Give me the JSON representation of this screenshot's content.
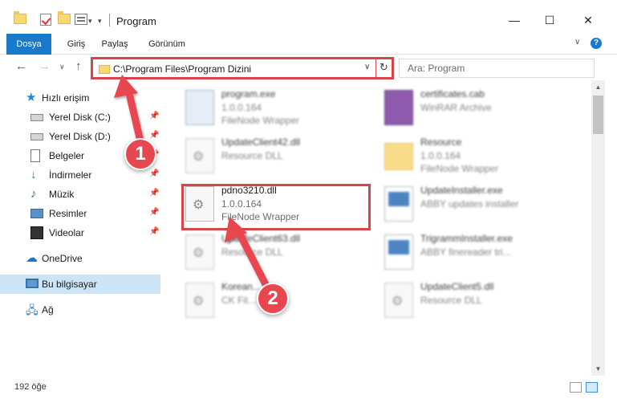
{
  "window": {
    "title": "Program",
    "minimize": "—",
    "maximize": "☐",
    "close": "✕"
  },
  "ribbon": {
    "tabs": [
      "Dosya",
      "Giriş",
      "Paylaş",
      "Görünüm"
    ],
    "collapse": "∨",
    "help": "?"
  },
  "nav": {
    "back": "←",
    "forward": "→",
    "recent": "∨",
    "up": "↑",
    "address": "C:\\Program Files\\Program Dizini",
    "address_dropdown": "∨",
    "refresh": "↻",
    "search_placeholder": "Ara: Program"
  },
  "sidebar": {
    "items": [
      {
        "label": "Hızlı erişim",
        "icon": "star-icon"
      },
      {
        "label": "Yerel Disk (C:)",
        "icon": "drive-icon",
        "pinned": true
      },
      {
        "label": "Yerel Disk (D:)",
        "icon": "drive-icon",
        "pinned": true
      },
      {
        "label": "Belgeler",
        "icon": "documents-icon",
        "pinned": true
      },
      {
        "label": "İndirmeler",
        "icon": "downloads-icon",
        "pinned": true
      },
      {
        "label": "Müzik",
        "icon": "music-icon",
        "pinned": true
      },
      {
        "label": "Resimler",
        "icon": "pictures-icon",
        "pinned": true
      },
      {
        "label": "Videolar",
        "icon": "videos-icon",
        "pinned": true
      },
      {
        "label": "OneDrive",
        "icon": "onedrive-icon"
      },
      {
        "label": "Bu bilgisayar",
        "icon": "computer-icon",
        "selected": true
      },
      {
        "label": "Ağ",
        "icon": "network-icon"
      }
    ],
    "pin_glyph": "📌"
  },
  "files": [
    {
      "name": "program.exe",
      "line1": "1.0.0.164",
      "line2": "FileNode Wrapper",
      "type": "exe"
    },
    {
      "name": "certificates.cab",
      "line1": "WinRAR Archive",
      "line2": "",
      "type": "rar"
    },
    {
      "name": "UpdateClient42.dll",
      "line1": "Resource DLL",
      "line2": "",
      "type": "dll"
    },
    {
      "name": "Resource",
      "line1": "1.0.0.164",
      "line2": "FileNode Wrapper",
      "type": "folder"
    },
    {
      "name": "pdno3210.dll",
      "line1": "1.0.0.164",
      "line2": "FileNode Wrapper",
      "type": "dll",
      "highlighted": true
    },
    {
      "name": "UpdateInstaller.exe",
      "line1": "ABBY updates installer",
      "line2": "",
      "type": "win"
    },
    {
      "name": "UpdateClient63.dll",
      "line1": "Resource DLL",
      "line2": "",
      "type": "dll"
    },
    {
      "name": "TrigrammInstaller.exe",
      "line1": "ABBY finereader tri...",
      "line2": "",
      "type": "win"
    },
    {
      "name": "Korean...",
      "line1": "CK Fil...",
      "line2": "",
      "type": "dll"
    },
    {
      "name": "UpdateClient5.dll",
      "line1": "Resource DLL",
      "line2": "",
      "type": "dll"
    }
  ],
  "scrollbar": {
    "up": "▲",
    "down": "▼"
  },
  "status": {
    "count": "192 öğe"
  },
  "annotations": {
    "step1": "1",
    "step2": "2"
  },
  "colors": {
    "accent": "#1979ca",
    "highlight": "#d9434a",
    "selected": "#cce4f7"
  }
}
